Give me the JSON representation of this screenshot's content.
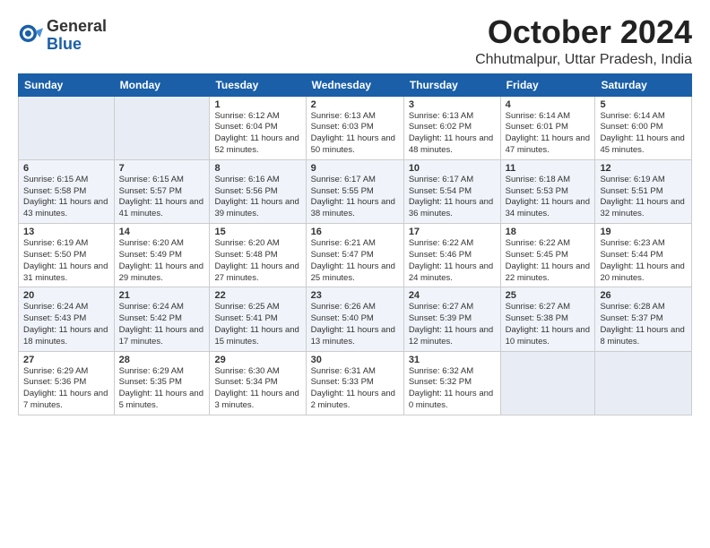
{
  "logo": {
    "general": "General",
    "blue": "Blue"
  },
  "title": "October 2024",
  "location": "Chhutmalpur, Uttar Pradesh, India",
  "days_of_week": [
    "Sunday",
    "Monday",
    "Tuesday",
    "Wednesday",
    "Thursday",
    "Friday",
    "Saturday"
  ],
  "weeks": [
    [
      {
        "day": "",
        "empty": true
      },
      {
        "day": "",
        "empty": true
      },
      {
        "day": "1",
        "sunrise": "6:12 AM",
        "sunset": "6:04 PM",
        "daylight": "11 hours and 52 minutes."
      },
      {
        "day": "2",
        "sunrise": "6:13 AM",
        "sunset": "6:03 PM",
        "daylight": "11 hours and 50 minutes."
      },
      {
        "day": "3",
        "sunrise": "6:13 AM",
        "sunset": "6:02 PM",
        "daylight": "11 hours and 48 minutes."
      },
      {
        "day": "4",
        "sunrise": "6:14 AM",
        "sunset": "6:01 PM",
        "daylight": "11 hours and 47 minutes."
      },
      {
        "day": "5",
        "sunrise": "6:14 AM",
        "sunset": "6:00 PM",
        "daylight": "11 hours and 45 minutes."
      }
    ],
    [
      {
        "day": "6",
        "sunrise": "6:15 AM",
        "sunset": "5:58 PM",
        "daylight": "11 hours and 43 minutes."
      },
      {
        "day": "7",
        "sunrise": "6:15 AM",
        "sunset": "5:57 PM",
        "daylight": "11 hours and 41 minutes."
      },
      {
        "day": "8",
        "sunrise": "6:16 AM",
        "sunset": "5:56 PM",
        "daylight": "11 hours and 39 minutes."
      },
      {
        "day": "9",
        "sunrise": "6:17 AM",
        "sunset": "5:55 PM",
        "daylight": "11 hours and 38 minutes."
      },
      {
        "day": "10",
        "sunrise": "6:17 AM",
        "sunset": "5:54 PM",
        "daylight": "11 hours and 36 minutes."
      },
      {
        "day": "11",
        "sunrise": "6:18 AM",
        "sunset": "5:53 PM",
        "daylight": "11 hours and 34 minutes."
      },
      {
        "day": "12",
        "sunrise": "6:19 AM",
        "sunset": "5:51 PM",
        "daylight": "11 hours and 32 minutes."
      }
    ],
    [
      {
        "day": "13",
        "sunrise": "6:19 AM",
        "sunset": "5:50 PM",
        "daylight": "11 hours and 31 minutes."
      },
      {
        "day": "14",
        "sunrise": "6:20 AM",
        "sunset": "5:49 PM",
        "daylight": "11 hours and 29 minutes."
      },
      {
        "day": "15",
        "sunrise": "6:20 AM",
        "sunset": "5:48 PM",
        "daylight": "11 hours and 27 minutes."
      },
      {
        "day": "16",
        "sunrise": "6:21 AM",
        "sunset": "5:47 PM",
        "daylight": "11 hours and 25 minutes."
      },
      {
        "day": "17",
        "sunrise": "6:22 AM",
        "sunset": "5:46 PM",
        "daylight": "11 hours and 24 minutes."
      },
      {
        "day": "18",
        "sunrise": "6:22 AM",
        "sunset": "5:45 PM",
        "daylight": "11 hours and 22 minutes."
      },
      {
        "day": "19",
        "sunrise": "6:23 AM",
        "sunset": "5:44 PM",
        "daylight": "11 hours and 20 minutes."
      }
    ],
    [
      {
        "day": "20",
        "sunrise": "6:24 AM",
        "sunset": "5:43 PM",
        "daylight": "11 hours and 18 minutes."
      },
      {
        "day": "21",
        "sunrise": "6:24 AM",
        "sunset": "5:42 PM",
        "daylight": "11 hours and 17 minutes."
      },
      {
        "day": "22",
        "sunrise": "6:25 AM",
        "sunset": "5:41 PM",
        "daylight": "11 hours and 15 minutes."
      },
      {
        "day": "23",
        "sunrise": "6:26 AM",
        "sunset": "5:40 PM",
        "daylight": "11 hours and 13 minutes."
      },
      {
        "day": "24",
        "sunrise": "6:27 AM",
        "sunset": "5:39 PM",
        "daylight": "11 hours and 12 minutes."
      },
      {
        "day": "25",
        "sunrise": "6:27 AM",
        "sunset": "5:38 PM",
        "daylight": "11 hours and 10 minutes."
      },
      {
        "day": "26",
        "sunrise": "6:28 AM",
        "sunset": "5:37 PM",
        "daylight": "11 hours and 8 minutes."
      }
    ],
    [
      {
        "day": "27",
        "sunrise": "6:29 AM",
        "sunset": "5:36 PM",
        "daylight": "11 hours and 7 minutes."
      },
      {
        "day": "28",
        "sunrise": "6:29 AM",
        "sunset": "5:35 PM",
        "daylight": "11 hours and 5 minutes."
      },
      {
        "day": "29",
        "sunrise": "6:30 AM",
        "sunset": "5:34 PM",
        "daylight": "11 hours and 3 minutes."
      },
      {
        "day": "30",
        "sunrise": "6:31 AM",
        "sunset": "5:33 PM",
        "daylight": "11 hours and 2 minutes."
      },
      {
        "day": "31",
        "sunrise": "6:32 AM",
        "sunset": "5:32 PM",
        "daylight": "11 hours and 0 minutes."
      },
      {
        "day": "",
        "empty": true
      },
      {
        "day": "",
        "empty": true
      }
    ]
  ]
}
